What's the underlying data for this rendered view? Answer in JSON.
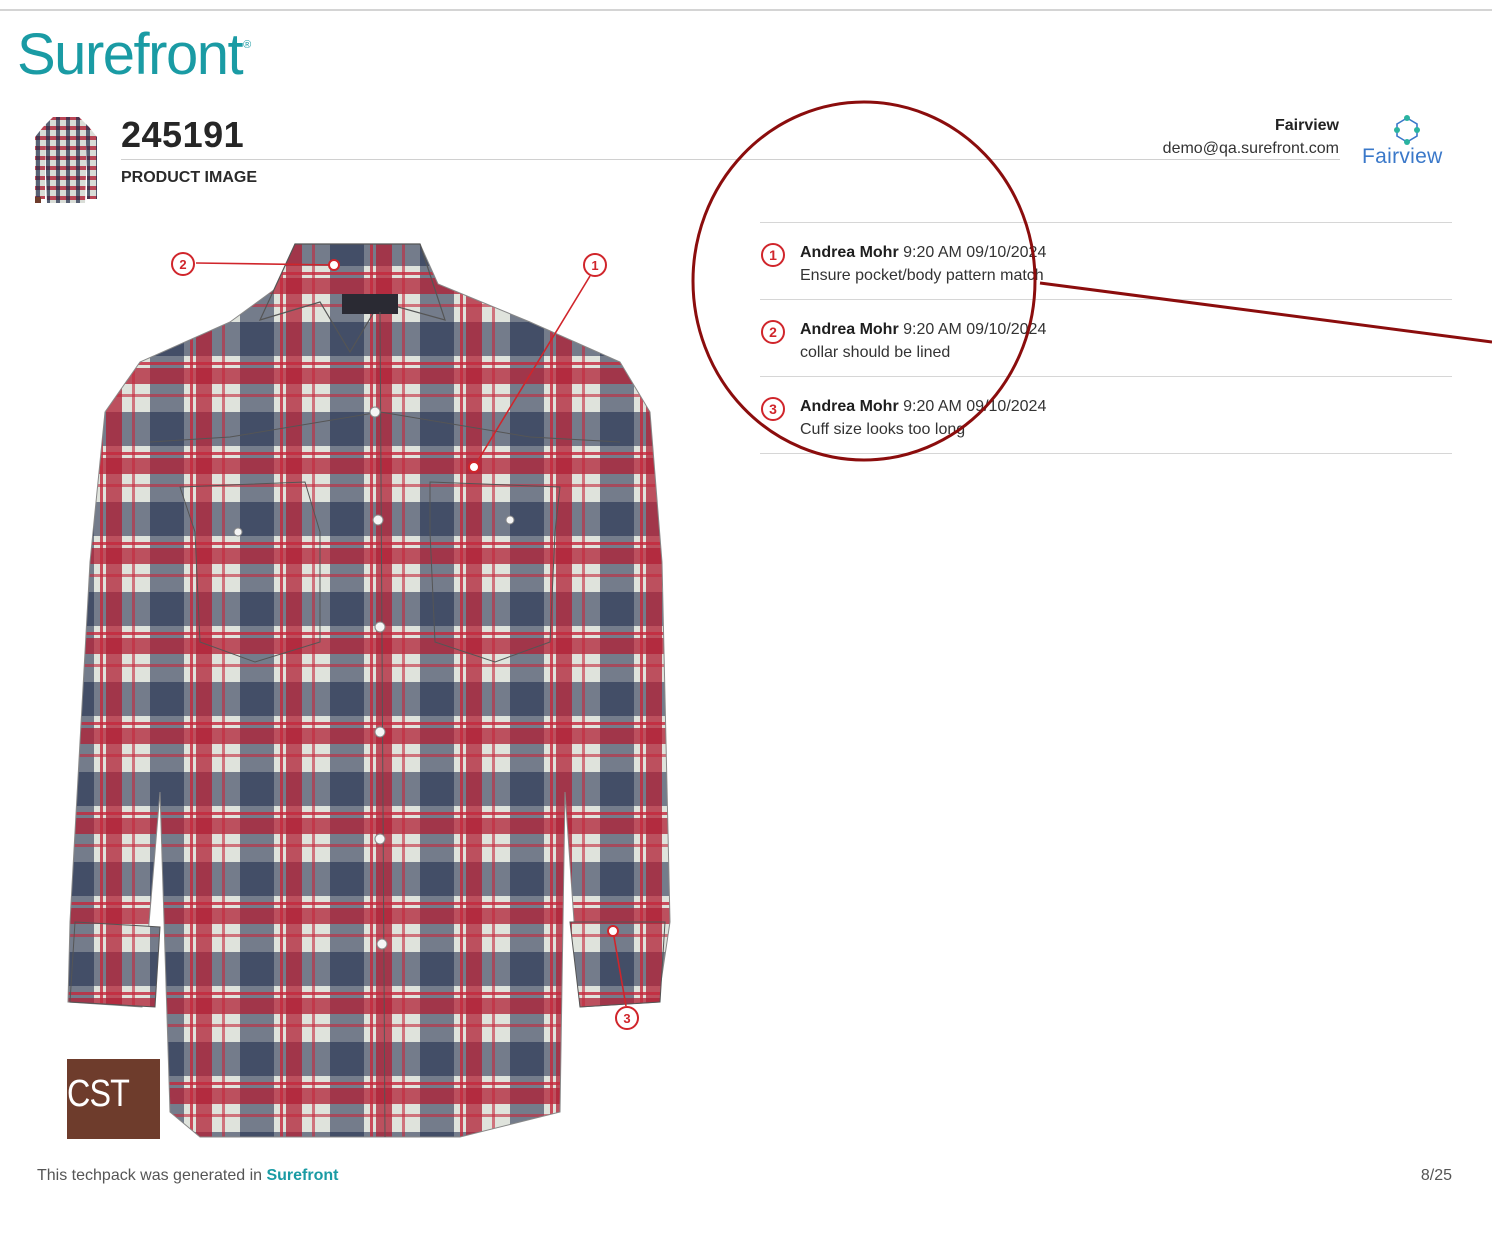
{
  "header": {
    "brand": "Surefront",
    "brand_mark": "®",
    "product_code": "245191",
    "section_title": "PRODUCT IMAGE",
    "company": "Fairview",
    "email": "demo@qa.surefront.com",
    "company_logo_text": "Fairview"
  },
  "product_image": {
    "label_text": "CST"
  },
  "markers": [
    "1",
    "2",
    "3"
  ],
  "comments": [
    {
      "number": "1",
      "author": "Andrea Mohr",
      "time": "9:20 AM 09/10/2024",
      "text": "Ensure pocket/body pattern match"
    },
    {
      "number": "2",
      "author": "Andrea Mohr",
      "time": "9:20 AM 09/10/2024",
      "text": "collar should be lined"
    },
    {
      "number": "3",
      "author": "Andrea Mohr",
      "time": "9:20 AM 09/10/2024",
      "text": "Cuff size looks too long"
    }
  ],
  "footer": {
    "text": "This techpack was generated in",
    "brand": "Surefront",
    "page": "8/25"
  },
  "colors": {
    "brand": "#1a9ba4",
    "marker": "#d0252b",
    "highlight_circle": "#8b0d0d",
    "company_logo": "#3a78c9"
  }
}
